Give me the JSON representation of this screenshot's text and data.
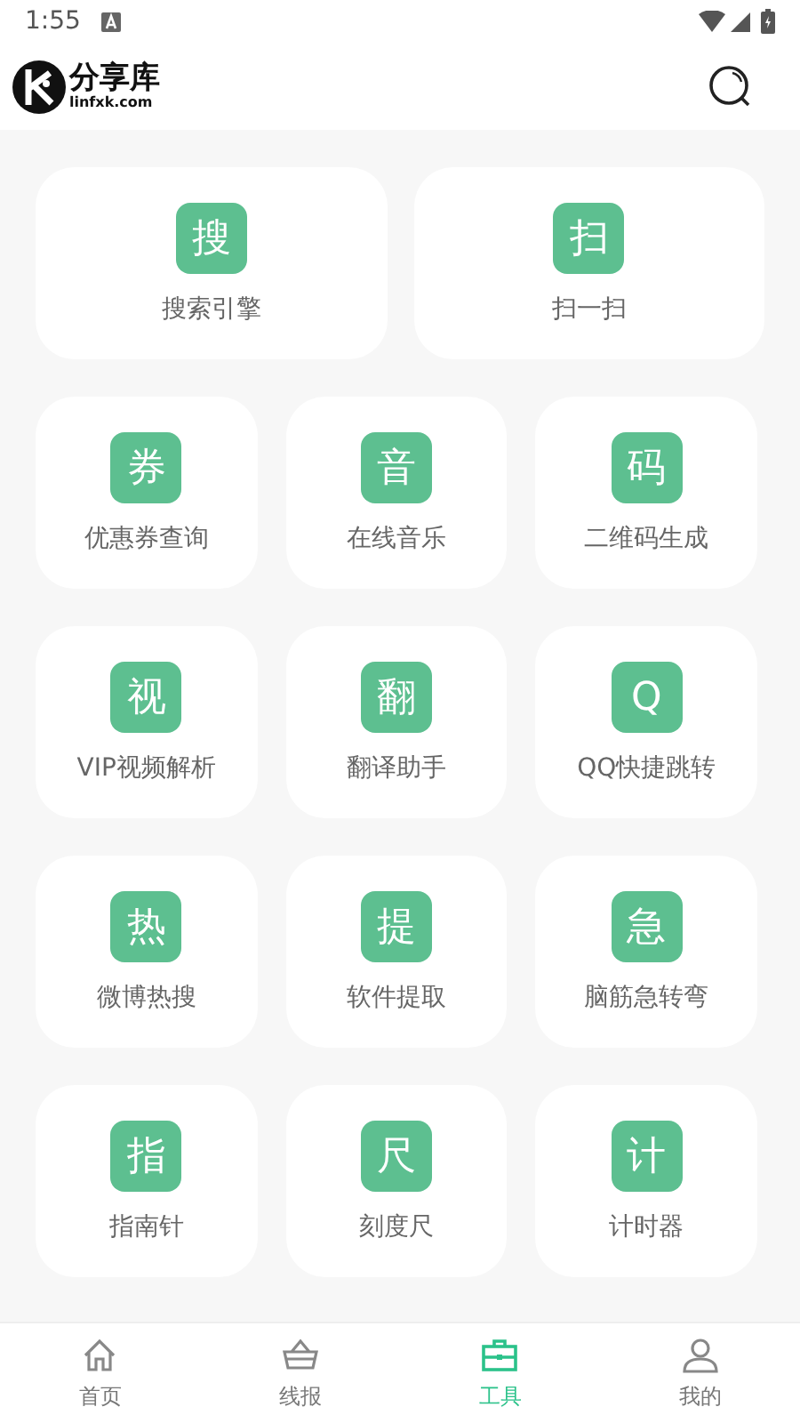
{
  "status_bar": {
    "time": "1:55"
  },
  "header": {
    "logo_title": "分享库",
    "logo_domain": "linfxk.com"
  },
  "featured": [
    {
      "glyph": "搜",
      "label": "搜索引擎"
    },
    {
      "glyph": "扫",
      "label": "扫一扫"
    }
  ],
  "tools": [
    {
      "glyph": "券",
      "label": "优惠券查询"
    },
    {
      "glyph": "音",
      "label": "在线音乐"
    },
    {
      "glyph": "码",
      "label": "二维码生成"
    },
    {
      "glyph": "视",
      "label": "VIP视频解析"
    },
    {
      "glyph": "翻",
      "label": "翻译助手"
    },
    {
      "glyph": "Q",
      "label": "QQ快捷跳转"
    },
    {
      "glyph": "热",
      "label": "微博热搜"
    },
    {
      "glyph": "提",
      "label": "软件提取"
    },
    {
      "glyph": "急",
      "label": "脑筋急转弯"
    },
    {
      "glyph": "指",
      "label": "指南针"
    },
    {
      "glyph": "尺",
      "label": "刻度尺"
    },
    {
      "glyph": "计",
      "label": "计时器"
    }
  ],
  "nav": [
    {
      "kind": "home",
      "label": "首页",
      "selected": false
    },
    {
      "kind": "basket",
      "label": "线报",
      "selected": false
    },
    {
      "kind": "toolbox",
      "label": "工具",
      "selected": true
    },
    {
      "kind": "person",
      "label": "我的",
      "selected": false
    }
  ]
}
